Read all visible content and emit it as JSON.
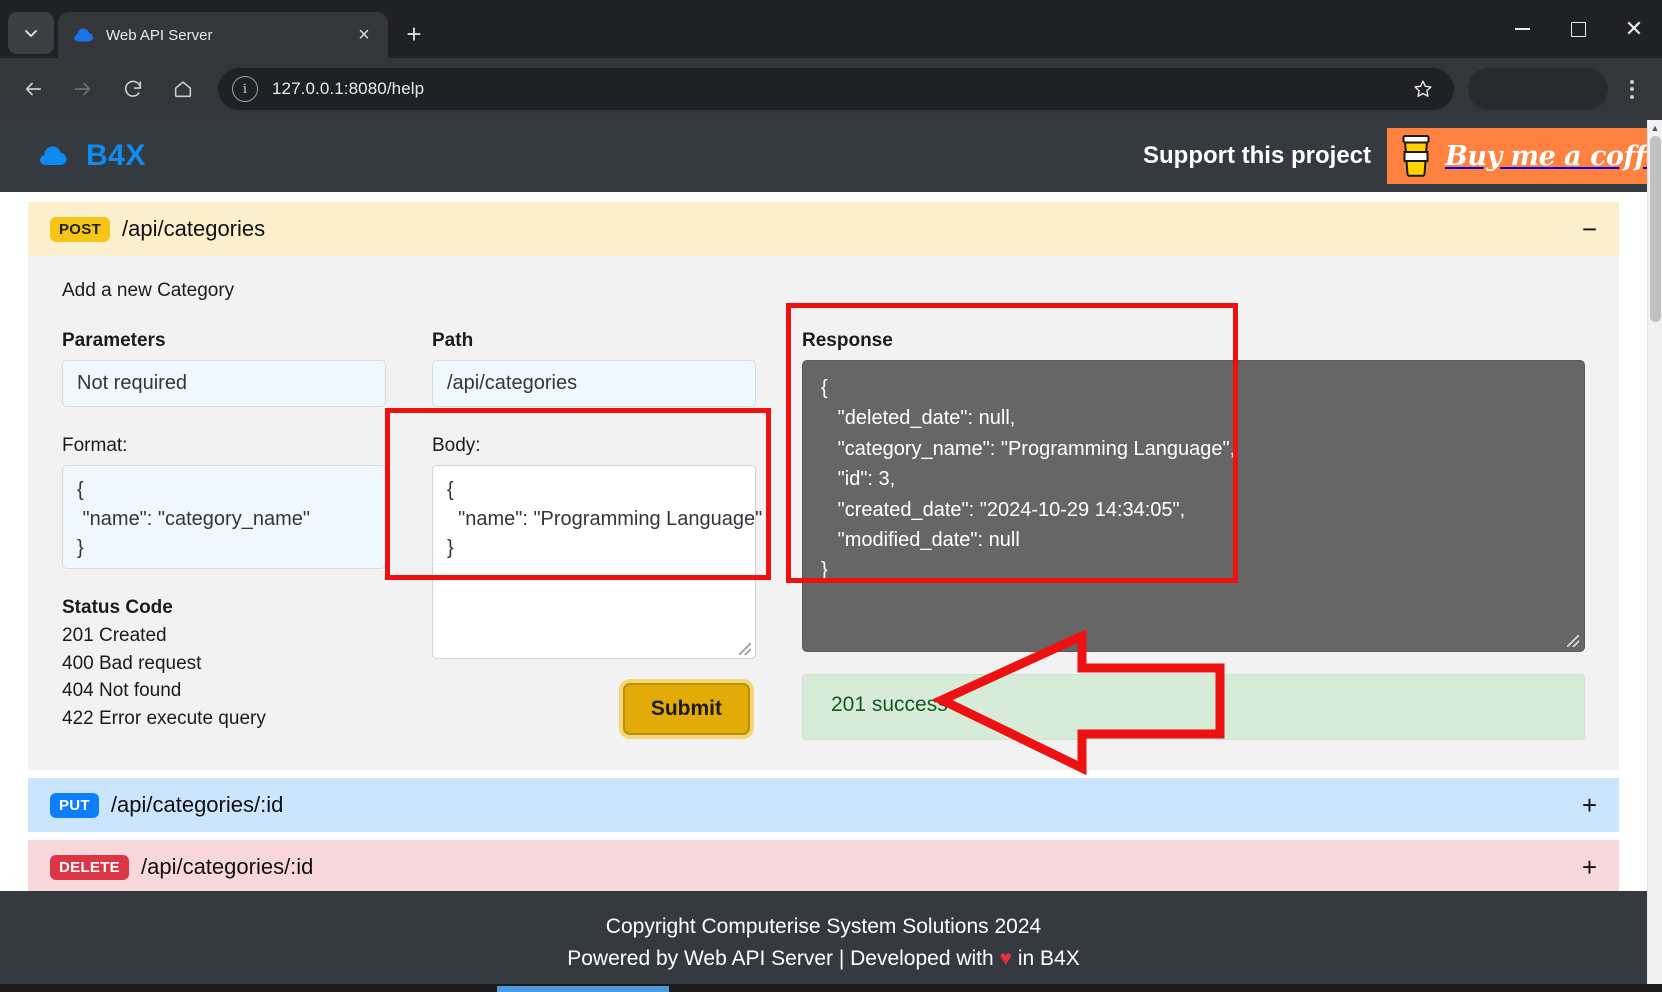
{
  "browser": {
    "tab": {
      "title": "Web API Server",
      "favicon": "cloud-icon",
      "close": "×"
    },
    "new_tab_label": "+",
    "tab_list_chevron": "⌄",
    "nav": {
      "back": "←",
      "forward": "→",
      "reload": "↻",
      "home": "⌂",
      "info": "i",
      "star": "☆",
      "menu": "kebab-menu-icon"
    },
    "url": "127.0.0.1:8080/help",
    "window": {
      "minimize": "–",
      "maximize": "□",
      "close": "✕"
    }
  },
  "site": {
    "brand": "B4X",
    "support_text": "Support this project",
    "buy_me_a_coffee": "Buy me a coffee"
  },
  "endpoints": [
    {
      "verb": "POST",
      "path": "/api/categories",
      "toggle": "−",
      "description": "Add a new Category",
      "parameters_label": "Parameters",
      "parameters_value": "Not required",
      "format_label": "Format:",
      "format_value": "{\n \"name\": \"category_name\"\n}",
      "status_title": "Status Code",
      "status_codes": [
        "201 Created",
        "400 Bad request",
        "404 Not found",
        "422 Error execute query"
      ],
      "path_label": "Path",
      "path_value": "/api/categories",
      "body_label": "Body:",
      "body_value": "{\n  \"name\": \"Programming Language\"\n}",
      "submit_label": "Submit",
      "response_label": "Response",
      "response_value": "{\n   \"deleted_date\": null,\n   \"category_name\": \"Programming Language\",\n   \"id\": 3,\n   \"created_date\": \"2024-10-29 14:34:05\",\n   \"modified_date\": null\n}",
      "alert_text": "201 success"
    },
    {
      "verb": "PUT",
      "path": "/api/categories/:id",
      "toggle": "+"
    },
    {
      "verb": "DELETE",
      "path": "/api/categories/:id",
      "toggle": "+"
    }
  ],
  "footer": {
    "line1": "Copyright Computerise System Solutions 2024",
    "line2_before": "Powered by Web API Server | Developed with ",
    "heart": "♥",
    "line2_after": " in B4X"
  },
  "scrollbar": {
    "up": "▲",
    "down": "▼"
  },
  "colors": {
    "accent_blue": "#0d8bf2",
    "post_bg": "#fcefcd",
    "put_bg": "#cce5ff",
    "delete_bg": "#f8d7da",
    "post_badge": "#f5c518",
    "put_badge": "#0d7efd",
    "delete_badge": "#dc3545",
    "header_dark": "#343a40",
    "coffee_orange": "#ff813f",
    "submit_gold": "#e3ab08",
    "response_grey": "#666666",
    "success_green_bg": "#d6ecd9",
    "success_green_text": "#155724",
    "annotation_red": "#ee1111"
  }
}
